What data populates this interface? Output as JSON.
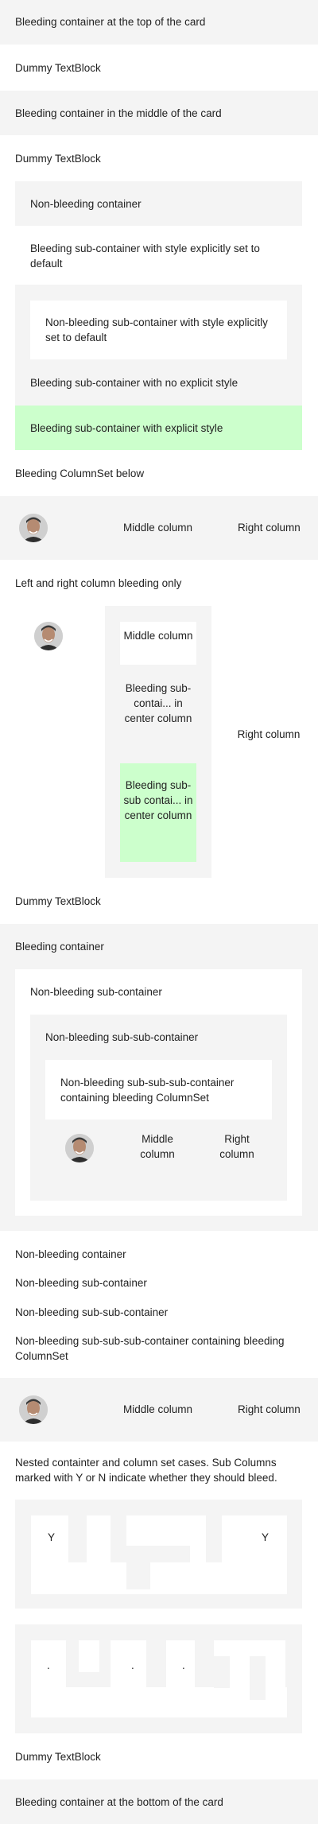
{
  "blocks": {
    "b1": "Bleeding container at the top of the card",
    "b2": "Dummy TextBlock",
    "b3": "Bleeding container in the middle of the card",
    "b4": "Dummy TextBlock",
    "b5": "Non-bleeding container",
    "b6": "Bleeding sub-container with style explicitly set to default",
    "b7": "Non-bleeding sub-container with style explicitly set to default",
    "b8": "Bleeding sub-container with no explicit style",
    "b9": "Bleeding sub-container with explicit style",
    "b10": "Bleeding ColumnSet below",
    "b11_mid": "Middle column",
    "b11_right": "Right column",
    "b12": "Left and right column bleeding only",
    "b13_mid": "Middle column",
    "b13_sub": "Bleeding sub-contai... in center column",
    "b13_sub2": "Bleeding sub-sub contai... in center column",
    "b13_right": "Right column",
    "b14": "Dummy TextBlock",
    "b15": "Bleeding container",
    "b16": "Non-bleeding sub-container",
    "b17": "Non-bleeding sub-sub-container",
    "b18": "Non-bleeding sub-sub-sub-container containing bleeding ColumnSet",
    "b19_mid": "Middle column",
    "b19_right": "Right column",
    "b20": "Non-bleeding container",
    "b21": "Non-bleeding sub-container",
    "b22": "Non-bleeding sub-sub-container",
    "b23": "Non-bleeding sub-sub-sub-container containing bleeding ColumnSet",
    "b24_mid": "Middle column",
    "b24_right": "Right column",
    "b25": "Nested containter and column set cases. Sub Columns marked with Y or N indicate whether they should bleed.",
    "b26_y1": "Y",
    "b26_y2": "Y",
    "b27_dot1": ".",
    "b27_dot2": ".",
    "b27_dot3": ".",
    "b28": "Dummy TextBlock",
    "b29": "Bleeding container at the bottom of the card"
  },
  "colors": {
    "emphasis": "#f4f4f4",
    "default": "#ffffff",
    "good": "#ccffcc"
  },
  "icons": [
    "person-avatar-icon"
  ]
}
